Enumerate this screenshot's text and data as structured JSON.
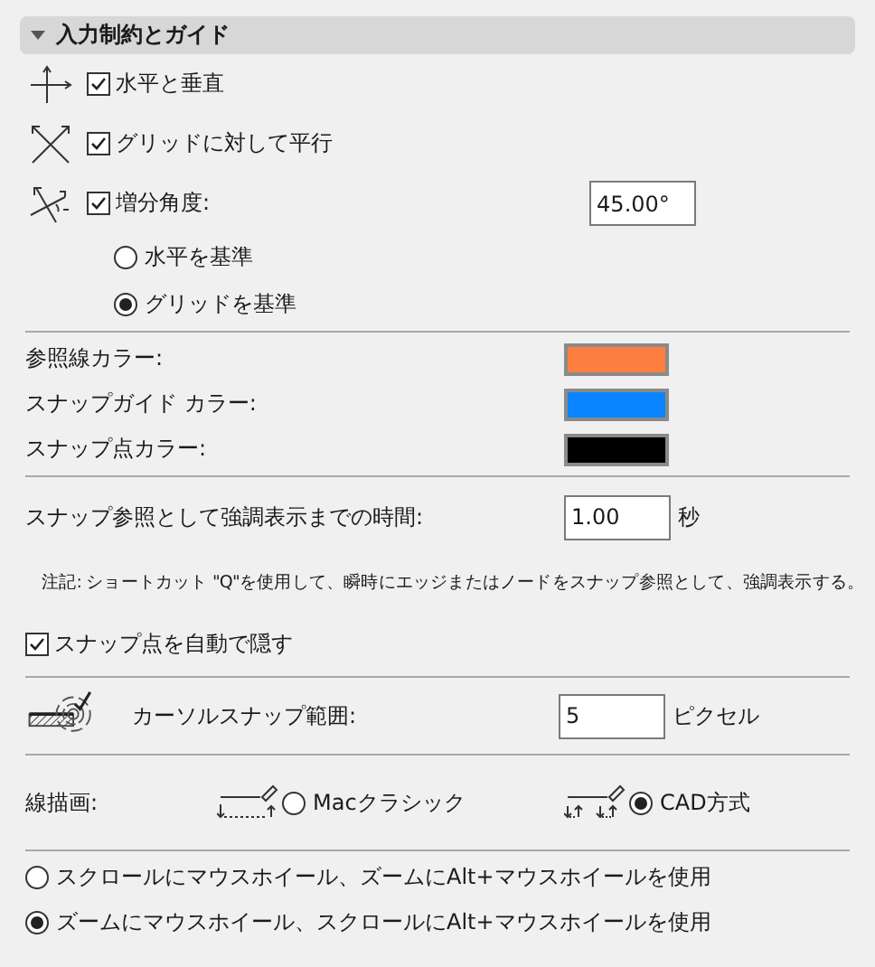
{
  "section": {
    "title": "入力制約とガイド",
    "expanded": true
  },
  "constraints": [
    {
      "kind": "orthogonal",
      "label": "水平と垂直",
      "checked": true
    },
    {
      "kind": "grid",
      "label": "グリッドに対して平行",
      "checked": true
    },
    {
      "kind": "angle",
      "label": "増分角度:",
      "checked": true,
      "value": "45.00°"
    }
  ],
  "angle_base": [
    {
      "label": "水平を基準",
      "selected": false
    },
    {
      "label": "グリッドを基準",
      "selected": true
    }
  ],
  "colors": [
    {
      "label": "参照線カラー:",
      "color": "#ff7f41"
    },
    {
      "label": "スナップガイド カラー:",
      "color": "#0a84ff"
    },
    {
      "label": "スナップ点カラー:",
      "color": "#000000"
    }
  ],
  "highlight_time": {
    "label": "スナップ参照として強調表示までの時間:",
    "value": "1.00",
    "unit": "秒"
  },
  "note": "注記: ショートカット \"Q\"を使用して、瞬時にエッジまたはノードをスナップ参照として、強調表示する。",
  "auto_hide": {
    "label": "スナップ点を自動で隠す",
    "checked": true
  },
  "cursor_snap": {
    "label": "カーソルスナップ範囲:",
    "value": "5",
    "unit": "ピクセル"
  },
  "line_drawing": {
    "label": "線描画:",
    "options": [
      {
        "kind": "classic",
        "label": "Macクラシック",
        "selected": false
      },
      {
        "kind": "cad",
        "label": "CAD方式",
        "selected": true
      }
    ]
  },
  "wheel": [
    {
      "label": "スクロールにマウスホイール、ズームにAlt+マウスホイールを使用",
      "selected": false
    },
    {
      "label": "ズームにマウスホイール、スクロールにAlt+マウスホイールを使用",
      "selected": true
    }
  ]
}
